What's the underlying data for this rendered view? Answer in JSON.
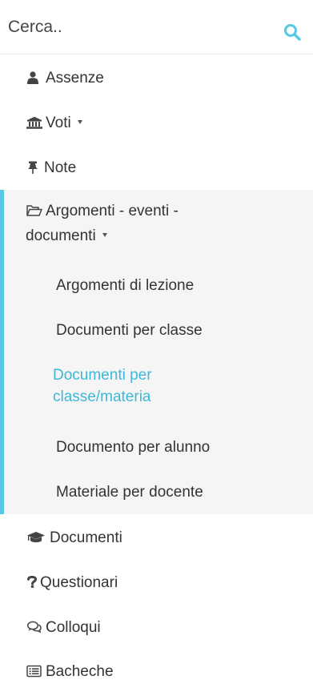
{
  "search": {
    "placeholder": "Cerca..",
    "icon": "search-icon"
  },
  "menu": {
    "items": [
      {
        "label": "Assenze",
        "icon": "user-icon"
      },
      {
        "label": "Voti",
        "icon": "bank-icon",
        "has_caret": true
      },
      {
        "label": "Note",
        "icon": "thumbtack-icon"
      },
      {
        "label_line1": "Argomenti - eventi -",
        "label_line2": "documenti",
        "icon": "folder-open-icon",
        "has_caret": true,
        "expanded": true
      },
      {
        "label": "Documenti",
        "icon": "graduation-cap-icon"
      },
      {
        "label": "Questionari",
        "icon": "question-icon"
      },
      {
        "label": "Colloqui",
        "icon": "comments-icon"
      },
      {
        "label": "Bacheche",
        "icon": "list-alt-icon"
      }
    ],
    "submenu": [
      {
        "label": "Argomenti di lezione"
      },
      {
        "label": "Documenti per classe"
      },
      {
        "label": "Documenti per classe/materia",
        "active": true
      },
      {
        "label": "Documento per alunno"
      },
      {
        "label": "Materiale per docente"
      }
    ]
  },
  "colors": {
    "accent": "#58c8e3",
    "active_text": "#3fb8d8",
    "group_background": "#f5f5f5"
  }
}
